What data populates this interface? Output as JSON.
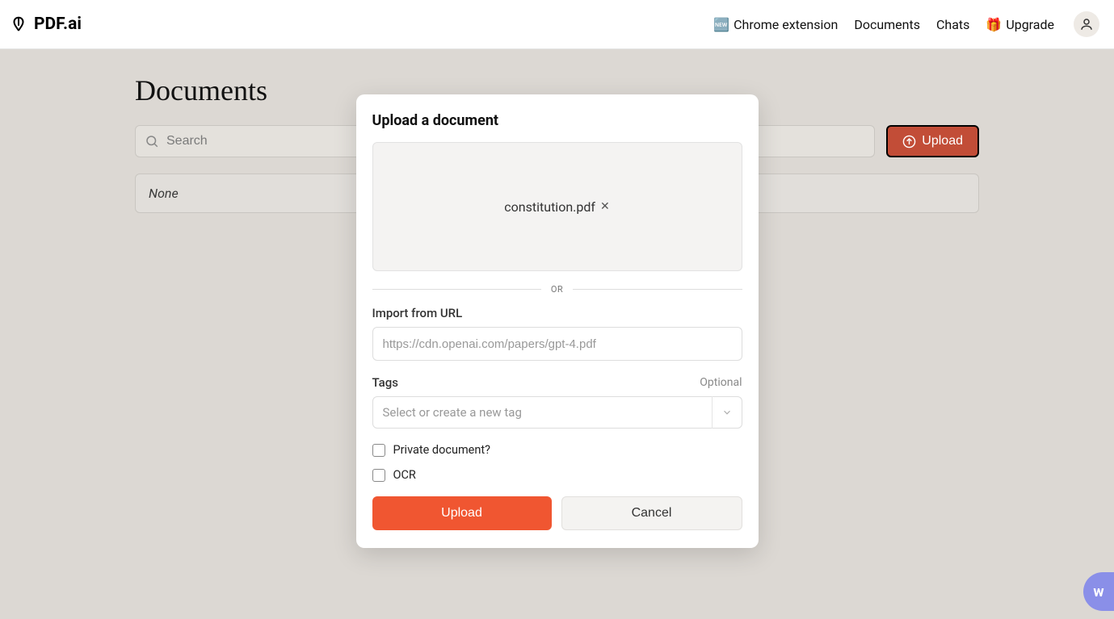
{
  "header": {
    "brand": "PDF.ai",
    "nav": {
      "chromeExtIcon": "🆕",
      "chromeExt": "Chrome extension",
      "documents": "Documents",
      "chats": "Chats",
      "upgradeIcon": "🎁",
      "upgrade": "Upgrade"
    }
  },
  "page": {
    "title": "Documents",
    "searchPlaceholder": "Search",
    "uploadBtn": "Upload",
    "emptyText": "None"
  },
  "modal": {
    "title": "Upload a document",
    "fileName": "constitution.pdf",
    "orLabel": "OR",
    "urlLabel": "Import from URL",
    "urlPlaceholder": "https://cdn.openai.com/papers/gpt-4.pdf",
    "tagsLabel": "Tags",
    "optional": "Optional",
    "tagsPlaceholder": "Select or create a new tag",
    "privateLabel": "Private document?",
    "ocrLabel": "OCR",
    "uploadBtn": "Upload",
    "cancelBtn": "Cancel"
  },
  "widget": {
    "label": "w"
  }
}
